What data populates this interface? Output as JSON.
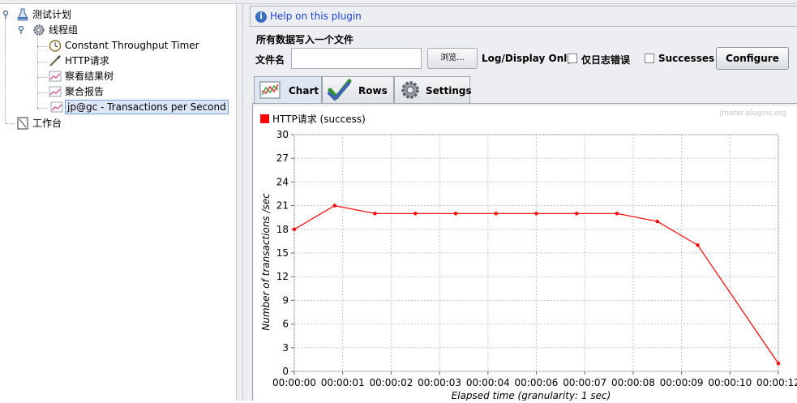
{
  "tree": {
    "items": [
      {
        "label": "测试计划",
        "icon": "flask-icon"
      },
      {
        "label": "线程组",
        "icon": "gear-icon"
      },
      {
        "label": "Constant Throughput Timer",
        "icon": "timer-icon"
      },
      {
        "label": "HTTP请求",
        "icon": "pipette-icon"
      },
      {
        "label": "察看结果树",
        "icon": "graph-icon"
      },
      {
        "label": "聚合报告",
        "icon": "graph-icon"
      },
      {
        "label": "jp@gc - Transactions per Second",
        "icon": "graph-icon",
        "selected": true
      },
      {
        "label": "工作台",
        "icon": "clipboard-icon"
      }
    ]
  },
  "help": {
    "link_text": "Help on this plugin"
  },
  "file_section": {
    "title": "所有数据写入一个文件",
    "filename_label": "文件名",
    "filename_value": "",
    "browse_label": "浏览...",
    "log_display_label": "Log/Display Only:",
    "errors_only_label": "仅日志错误",
    "errors_only_checked": false,
    "successes_label": "Successes",
    "successes_checked": false,
    "configure_label": "Configure"
  },
  "tabs": [
    {
      "label": "Chart",
      "icon": "chart-icon",
      "active": true
    },
    {
      "label": "Rows",
      "icon": "checkmark-icon",
      "active": false
    },
    {
      "label": "Settings",
      "icon": "gear-icon",
      "active": false
    }
  ],
  "chart_data": {
    "type": "line",
    "watermark": "jmeter-plugins.org",
    "xlabel": "Elapsed time (granularity: 1 sec)",
    "ylabel": "Number of transactions /sec",
    "ylim": [
      0,
      30
    ],
    "yticks": [
      0,
      3,
      6,
      9,
      12,
      15,
      18,
      21,
      24,
      27,
      30
    ],
    "xlim": [
      0,
      12
    ],
    "xticks": [
      "00:00:00",
      "00:00:01",
      "00:00:02",
      "00:00:03",
      "00:00:04",
      "00:00:06",
      "00:00:07",
      "00:00:08",
      "00:00:09",
      "00:00:10",
      "00:00:12"
    ],
    "grid": true,
    "legend_position": "top-left",
    "series": [
      {
        "name": "HTTP请求 (success)",
        "color": "#ff0000",
        "x": [
          0,
          1,
          2,
          3,
          4,
          5,
          6,
          7,
          8,
          9,
          10,
          12
        ],
        "y": [
          18,
          21,
          20,
          20,
          20,
          20,
          20,
          20,
          20,
          19,
          16,
          1
        ]
      }
    ]
  }
}
